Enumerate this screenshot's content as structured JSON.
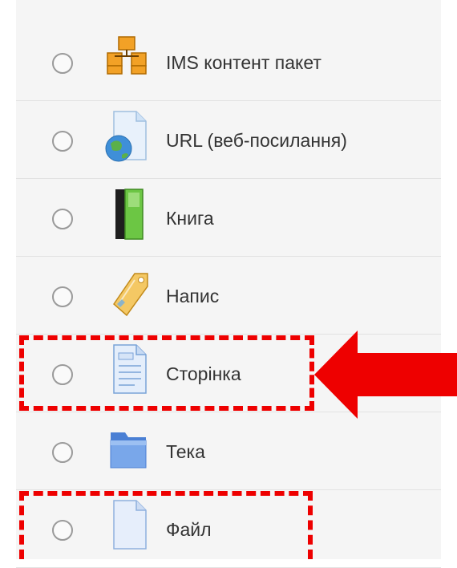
{
  "activity_chooser": {
    "items": [
      {
        "label": "IMS контент пакет",
        "icon": "ims-package-icon"
      },
      {
        "label": "URL (веб-посилання)",
        "icon": "url-globe-icon"
      },
      {
        "label": "Книга",
        "icon": "book-icon"
      },
      {
        "label": "Напис",
        "icon": "label-tag-icon"
      },
      {
        "label": "Сторінка",
        "icon": "page-icon"
      },
      {
        "label": "Тека",
        "icon": "folder-icon"
      },
      {
        "label": "Файл",
        "icon": "file-icon"
      }
    ],
    "highlighted": [
      "Сторінка",
      "Файл"
    ]
  },
  "annotations": {
    "highlight_color": "#ee0000",
    "arrow_target": "Сторінка"
  }
}
